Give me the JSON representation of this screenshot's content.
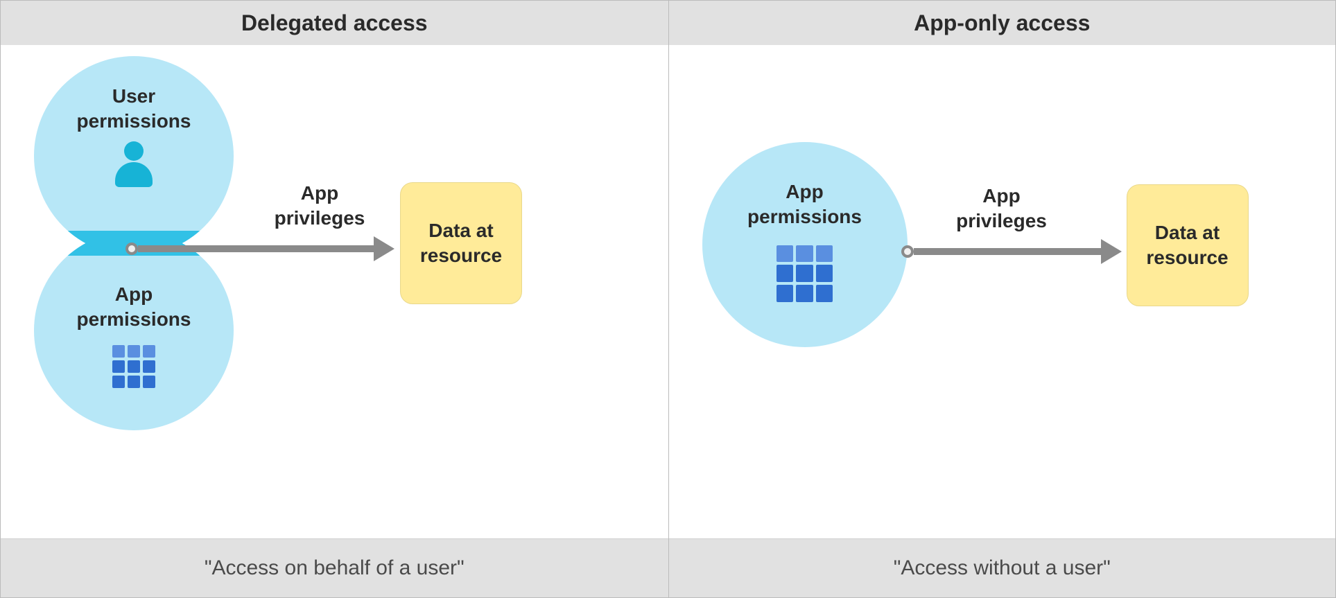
{
  "left": {
    "title": "Delegated access",
    "footer": "\"Access on behalf of a user\"",
    "user_perms_label_l1": "User",
    "user_perms_label_l2": "permissions",
    "app_perms_label_l1": "App",
    "app_perms_label_l2": "permissions",
    "arrow_label_l1": "App",
    "arrow_label_l2": "privileges",
    "resource_l1": "Data at",
    "resource_l2": "resource"
  },
  "right": {
    "title": "App-only access",
    "footer": "\"Access without a user\"",
    "app_perms_label_l1": "App",
    "app_perms_label_l2": "permissions",
    "arrow_label_l1": "App",
    "arrow_label_l2": "privileges",
    "resource_l1": "Data at",
    "resource_l2": "resource"
  },
  "icons": {
    "user": "user-icon",
    "grid": "grid-icon"
  },
  "colors": {
    "circle_fill": "#b7e7f7",
    "intersection": "#31c1e6",
    "arrow": "#8a8a8a",
    "resource_fill": "#ffeb99",
    "resource_border": "#e9d88a",
    "header_bg": "#e1e1e1"
  }
}
